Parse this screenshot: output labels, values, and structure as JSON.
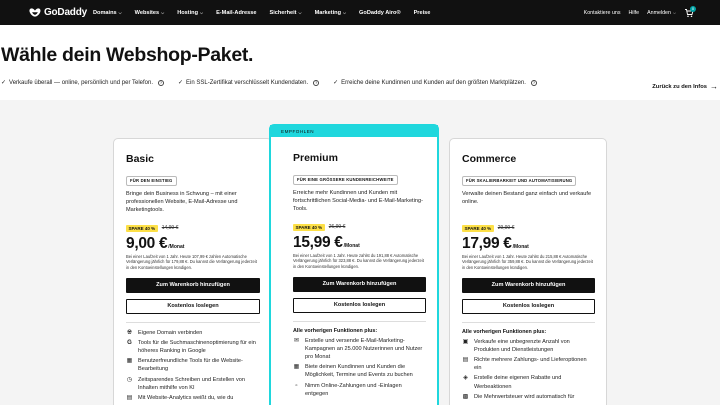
{
  "nav": {
    "logo_text": "GoDaddy",
    "items": [
      {
        "label": "Domains",
        "has_menu": true
      },
      {
        "label": "Websites",
        "has_menu": true
      },
      {
        "label": "Hosting",
        "has_menu": true
      },
      {
        "label": "E-Mail-Adresse",
        "has_menu": false
      },
      {
        "label": "Sicherheit",
        "has_menu": true
      },
      {
        "label": "Marketing",
        "has_menu": true
      },
      {
        "label": "GoDaddy Airo®",
        "has_menu": false
      },
      {
        "label": "Preise",
        "has_menu": false
      }
    ],
    "right": {
      "contact": "Kontaktiere uns",
      "help": "Hilfe",
      "signin": "Anmelden",
      "cart_count": "0"
    }
  },
  "hero": {
    "title": "Wähle dein Webshop-Paket.",
    "features": [
      "Verkaufe überall — online, persönlich und per Telefon.",
      "Ein SSL-Zertifikat verschlüsselt Kundendaten.",
      "Erreiche deine Kundinnen und Kunden auf den größten Marktplätzen."
    ],
    "back_link": "Zurück zu den Infos"
  },
  "plans": [
    {
      "name": "Basic",
      "featured": false,
      "badge": "FÜR DEN EINSTIEG",
      "description": "Bringe dein Business in Schwung – mit einer professionellen Website, E-Mail-Adresse und Marketingtools.",
      "save": "SPARE 40 %",
      "original_price": "14,99 €",
      "price": "9,00 €",
      "per": "/Monat",
      "fine_print": "Bei einer Laufzeit von 1 Jahr. Heute 107,99 € zahlen Automatische Verlängerung jährlich für 179,88 €. Du kannst die Verlängerung jederzeit in den Kontoeinstellungen kündigen.",
      "cta_primary": "Zum Warenkorb hinzufügen",
      "cta_secondary": "Kostenlos loslegen",
      "features_heading": "",
      "features": [
        {
          "icon": "globe-icon",
          "text": "Eigene Domain verbinden"
        },
        {
          "icon": "google-icon",
          "text": "Tools für die Suchmaschinenoptimierung für ein höheres Ranking in Google"
        },
        {
          "icon": "layout-icon",
          "text": "Benutzerfreundliche Tools für die Website-Bearbeitung"
        },
        {
          "icon": "clock-icon",
          "text": "Zeitsparendes Schreiben und Erstellen von Inhalten mithilfe von KI"
        },
        {
          "icon": "analytics-icon",
          "text": "Mit Website-Analytics weißt du, wie du"
        }
      ]
    },
    {
      "name": "Premium",
      "featured": true,
      "recommended_label": "EMPFOHLEN",
      "badge": "FÜR EINE GRÖSSERE KUNDENREICHWEITE",
      "description": "Erreiche mehr Kundinnen und Kunden mit fortschrittlichen Social-Media- und E-Mail-Marketing-Tools.",
      "save": "SPARE 40 %",
      "original_price": "26,99 €",
      "price": "15,99 €",
      "per": "/Monat",
      "fine_print": "Bei einer Laufzeit von 1 Jahr. Heute zahlst du 191,88 € Automatische Verlängerung jährlich für 323,88 €. Du kannst die Verlängerung jederzeit in den Kontoeinstellungen kündigen.",
      "cta_primary": "Zum Warenkorb hinzufügen",
      "cta_secondary": "Kostenlos loslegen",
      "features_heading": "Alle vorherigen Funktionen plus:",
      "features": [
        {
          "icon": "mail-icon",
          "text": "Erstelle und versende E-Mail-Marketing-Kampagnen an 25.000 Nutzerinnen und Nutzer pro Monat"
        },
        {
          "icon": "calendar-icon",
          "text": "Biete deinen Kundinnen und Kunden die Möglichkeit, Termine und Events zu buchen"
        },
        {
          "icon": "payment-icon",
          "text": "Nimm Online-Zahlungen und -Einlagen entgegen"
        }
      ]
    },
    {
      "name": "Commerce",
      "featured": false,
      "badge": "FÜR SKALIERBARKEIT UND AUTOMATISIERUNG",
      "description": "Verwalte deinen Bestand ganz einfach und verkaufe online.",
      "save": "SPARE 40 %",
      "original_price": "29,99 €",
      "price": "17,99 €",
      "per": "/Monat",
      "fine_print": "Bei einer Laufzeit von 1 Jahr. Heute zahlst du 215,88 € Automatische Verlängerung jährlich für 359,88 €. Du kannst die Verlängerung jederzeit in den Kontoeinstellungen kündigen.",
      "cta_primary": "Zum Warenkorb hinzufügen",
      "cta_secondary": "Kostenlos loslegen",
      "features_heading": "Alle vorherigen Funktionen plus:",
      "features": [
        {
          "icon": "box-icon",
          "text": "Verkaufe eine unbegrenzte Anzahl von Produkten und Dienstleistungen"
        },
        {
          "icon": "shipping-icon",
          "text": "Richte mehrere Zahlungs- und Lieferoptionen ein"
        },
        {
          "icon": "tag-icon",
          "text": "Erstelle deine eigenen Rabatte und Werbeaktionen"
        },
        {
          "icon": "tax-icon",
          "text": "Die Mehrwertsteuer wird automatisch für"
        }
      ]
    }
  ]
}
